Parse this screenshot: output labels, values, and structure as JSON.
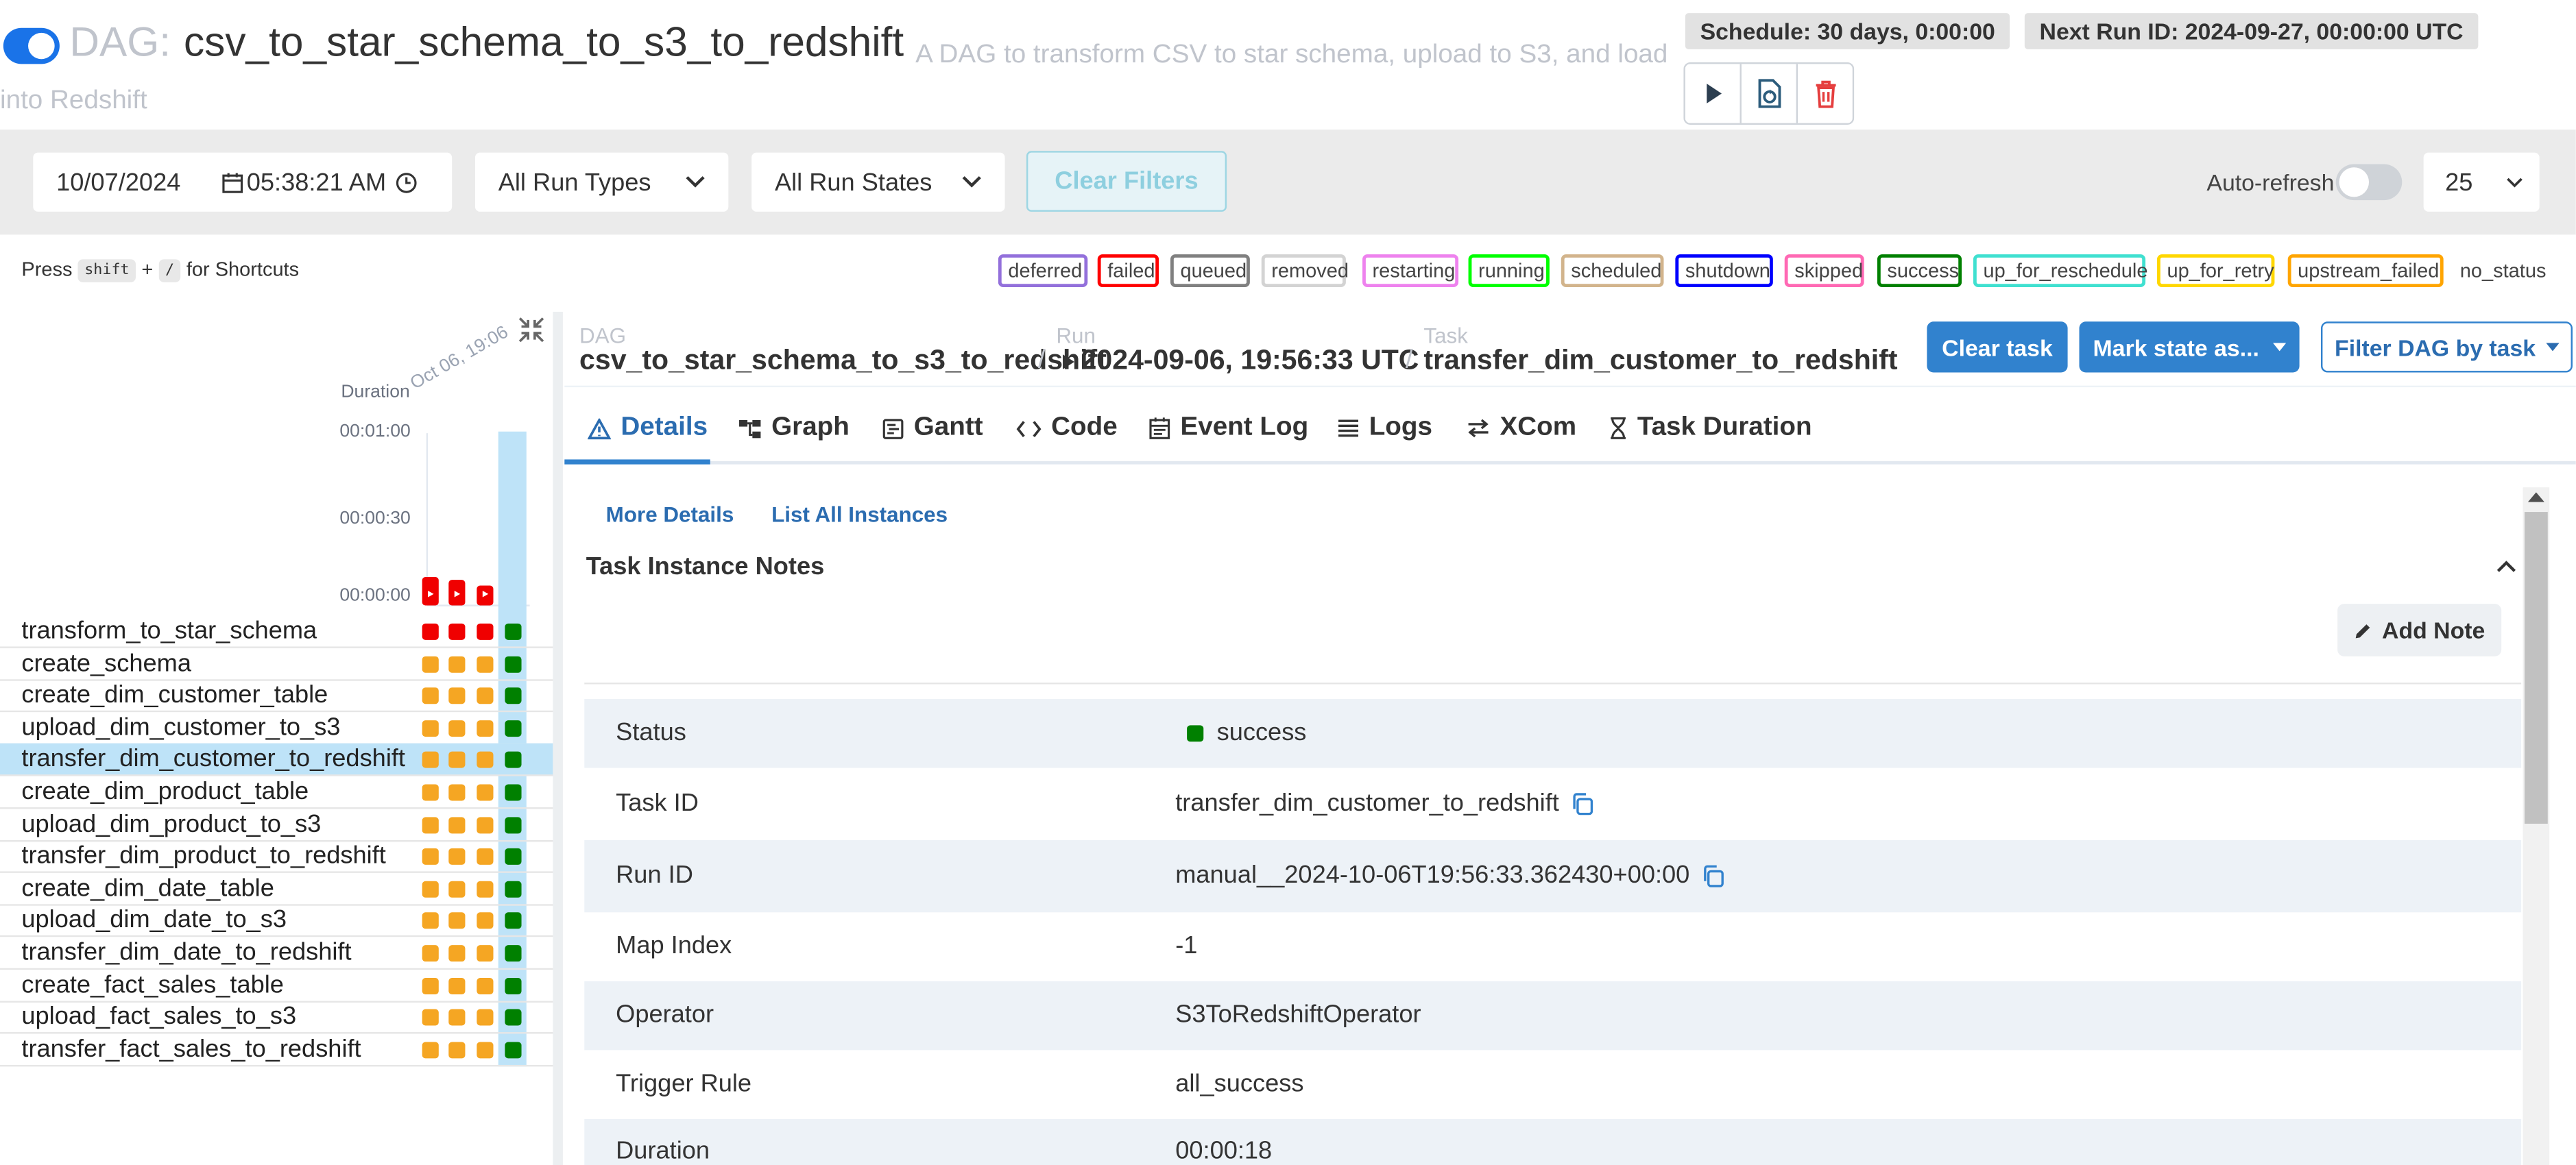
{
  "header": {
    "dag_prefix": "DAG:",
    "dag_id": "csv_to_star_schema_to_s3_to_redshift",
    "description": "A DAG to transform CSV to star schema, upload to S3, and load into Redshift",
    "schedule": "Schedule: 30 days, 0:00:00",
    "next_run": "Next Run ID: 2024-09-27, 00:00:00 UTC",
    "actions": [
      "play-icon",
      "refresh-dag-icon",
      "trash-icon"
    ]
  },
  "filters": {
    "date": "10/07/2024",
    "time": "05:38:21 AM",
    "run_types": "All Run Types",
    "run_states": "All Run States",
    "clear_filters": "Clear Filters",
    "auto_refresh": "Auto-refresh",
    "page_size": "25"
  },
  "shortcuts": {
    "press": "Press",
    "key1": "shift",
    "plus": "+",
    "key2": "/",
    "suffix": "for Shortcuts"
  },
  "legend": [
    {
      "label": "deferred",
      "color": "#9370db"
    },
    {
      "label": "failed",
      "color": "#ff0000"
    },
    {
      "label": "queued",
      "color": "#808080"
    },
    {
      "label": "removed",
      "color": "#d3d3d3"
    },
    {
      "label": "restarting",
      "color": "#ee82ee"
    },
    {
      "label": "running",
      "color": "#00ff00"
    },
    {
      "label": "scheduled",
      "color": "#d2b48c"
    },
    {
      "label": "shutdown",
      "color": "#0000ff"
    },
    {
      "label": "skipped",
      "color": "#ff69b4"
    },
    {
      "label": "success",
      "color": "#008000"
    },
    {
      "label": "up_for_reschedule",
      "color": "#40e0d0"
    },
    {
      "label": "up_for_retry",
      "color": "#ffd700"
    },
    {
      "label": "upstream_failed",
      "color": "#ffa500"
    }
  ],
  "no_status": "no_status",
  "grid": {
    "duration_label": "Duration",
    "run_date_label": "Oct 06, 19:06",
    "y_ticks": [
      "00:01:00",
      "00:00:30",
      "00:00:00"
    ],
    "runs": [
      {
        "duration_seconds": 10,
        "state": "failed"
      },
      {
        "duration_seconds": 9,
        "state": "failed"
      },
      {
        "duration_seconds": 7,
        "state": "failed"
      },
      {
        "duration_seconds": 50,
        "state": "success"
      }
    ],
    "tasks": [
      {
        "name": "transform_to_star_schema",
        "states": [
          "failed",
          "failed",
          "failed",
          "success"
        ]
      },
      {
        "name": "create_schema",
        "states": [
          "upstream_failed",
          "upstream_failed",
          "upstream_failed",
          "success"
        ]
      },
      {
        "name": "create_dim_customer_table",
        "states": [
          "upstream_failed",
          "upstream_failed",
          "upstream_failed",
          "success"
        ]
      },
      {
        "name": "upload_dim_customer_to_s3",
        "states": [
          "upstream_failed",
          "upstream_failed",
          "upstream_failed",
          "success"
        ]
      },
      {
        "name": "transfer_dim_customer_to_redshift",
        "states": [
          "upstream_failed",
          "upstream_failed",
          "upstream_failed",
          "success"
        ],
        "selected": true
      },
      {
        "name": "create_dim_product_table",
        "states": [
          "upstream_failed",
          "upstream_failed",
          "upstream_failed",
          "success"
        ]
      },
      {
        "name": "upload_dim_product_to_s3",
        "states": [
          "upstream_failed",
          "upstream_failed",
          "upstream_failed",
          "success"
        ]
      },
      {
        "name": "transfer_dim_product_to_redshift",
        "states": [
          "upstream_failed",
          "upstream_failed",
          "upstream_failed",
          "success"
        ]
      },
      {
        "name": "create_dim_date_table",
        "states": [
          "upstream_failed",
          "upstream_failed",
          "upstream_failed",
          "success"
        ]
      },
      {
        "name": "upload_dim_date_to_s3",
        "states": [
          "upstream_failed",
          "upstream_failed",
          "upstream_failed",
          "success"
        ]
      },
      {
        "name": "transfer_dim_date_to_redshift",
        "states": [
          "upstream_failed",
          "upstream_failed",
          "upstream_failed",
          "success"
        ]
      },
      {
        "name": "create_fact_sales_table",
        "states": [
          "upstream_failed",
          "upstream_failed",
          "upstream_failed",
          "success"
        ]
      },
      {
        "name": "upload_fact_sales_to_s3",
        "states": [
          "upstream_failed",
          "upstream_failed",
          "upstream_failed",
          "success"
        ]
      },
      {
        "name": "transfer_fact_sales_to_redshift",
        "states": [
          "upstream_failed",
          "upstream_failed",
          "upstream_failed",
          "success"
        ]
      }
    ]
  },
  "breadcrumb": {
    "dag_label": "DAG",
    "dag_value": "csv_to_star_schema_to_s3_to_redshift",
    "run_label": "Run",
    "run_value": "2024-09-06, 19:56:33 UTC",
    "task_label": "Task",
    "task_value": "transfer_dim_customer_to_redshift",
    "separator": "/"
  },
  "task_actions": {
    "clear_task": "Clear task",
    "mark_state": "Mark state as...",
    "filter_dag": "Filter DAG by task"
  },
  "tabs": [
    {
      "label": "Details",
      "icon": "warning-triangle-icon"
    },
    {
      "label": "Graph",
      "icon": "graph-icon"
    },
    {
      "label": "Gantt",
      "icon": "gantt-icon"
    },
    {
      "label": "Code",
      "icon": "code-icon"
    },
    {
      "label": "Event Log",
      "icon": "calendar-icon"
    },
    {
      "label": "Logs",
      "icon": "list-icon"
    },
    {
      "label": "XCom",
      "icon": "exchange-icon"
    },
    {
      "label": "Task Duration",
      "icon": "hourglass-icon"
    }
  ],
  "details": {
    "links": {
      "more_details": "More Details",
      "list_instances": "List All Instances"
    },
    "notes_title": "Task Instance Notes",
    "add_note": "Add Note",
    "rows": [
      {
        "key": "Status",
        "value": "success",
        "status_color": "#008000"
      },
      {
        "key": "Task ID",
        "value": "transfer_dim_customer_to_redshift",
        "copy": true
      },
      {
        "key": "Run ID",
        "value": "manual__2024-10-06T19:56:33.362430+00:00",
        "copy": true
      },
      {
        "key": "Map Index",
        "value": "-1"
      },
      {
        "key": "Operator",
        "value": "S3ToRedshiftOperator"
      },
      {
        "key": "Trigger Rule",
        "value": "all_success"
      },
      {
        "key": "Duration",
        "value": "00:00:18"
      }
    ]
  }
}
